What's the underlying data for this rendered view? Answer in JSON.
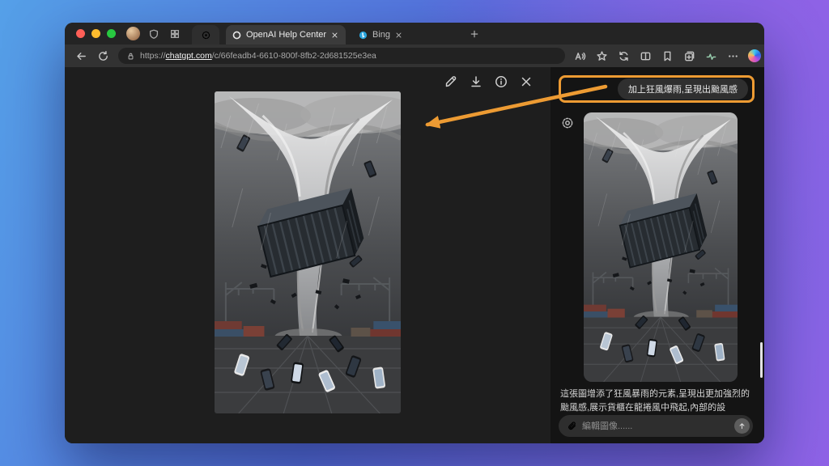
{
  "colors": {
    "annotation": "#ED9B33",
    "desktopBlue": "#55A0E8",
    "desktopMid": "#5570DD",
    "desktopPurple": "#8F62E6"
  },
  "tab_strip": {
    "tabs": [
      {
        "label": "OpenAI Help Center",
        "active": true
      },
      {
        "label": "Bing",
        "active": false
      }
    ]
  },
  "address_bar": {
    "scheme": "https://",
    "domain": "chatgpt.com",
    "path": "/c/66feadb4-6610-800f-8fb2-2d681525e3ea"
  },
  "side_panel": {
    "prompt": "加上狂風爆雨,呈現出颱風感",
    "caption": "這張圖增添了狂風暴雨的元素,呈現出更加強烈的颱風感,展示貨櫃在龍捲風中飛起,內部的設",
    "input_placeholder": "編輯圖像......"
  }
}
